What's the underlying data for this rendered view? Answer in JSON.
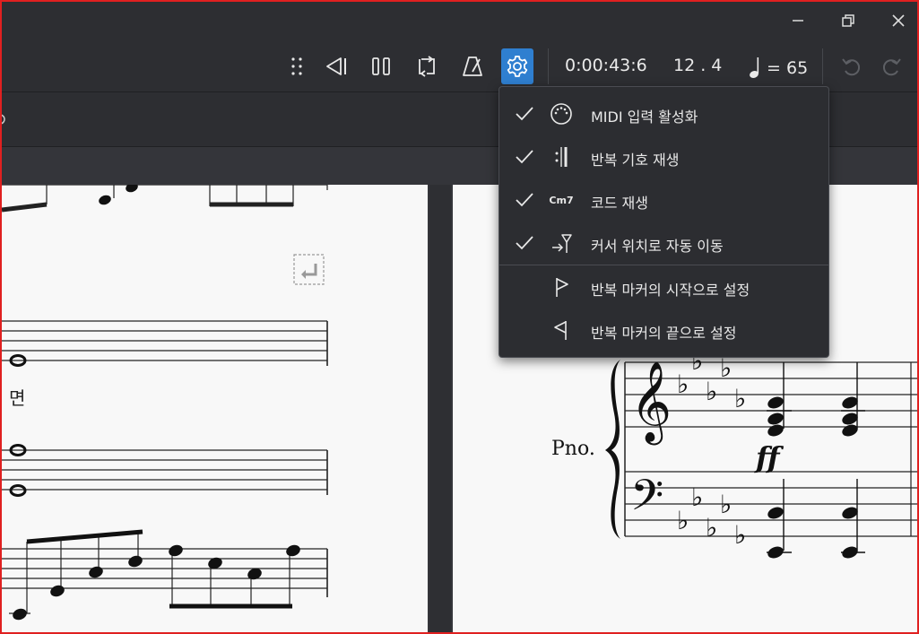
{
  "window": {
    "minimize_icon": "minimize-icon",
    "maximize_icon": "restore-icon",
    "close_icon": "close-icon"
  },
  "toolbar": {
    "time": "0:00:43:6",
    "position": "12 . 4",
    "tempo_equals": "= 65",
    "icons": [
      "drag-handle-icon",
      "rewind-icon",
      "pause-icon",
      "loop-icon",
      "metronome-icon",
      "settings-icon",
      "undo-icon",
      "redo-icon"
    ]
  },
  "menu": {
    "items": [
      {
        "label": "MIDI 입력 활성화",
        "checked": true,
        "icon": "midi-icon"
      },
      {
        "label": "반복 기호 재생",
        "checked": true,
        "icon": "repeat-sign-icon"
      },
      {
        "label": "코드 재생",
        "checked": true,
        "icon": "chord-icon",
        "icon_text": "Cm7"
      },
      {
        "label": "커서 위치로 자동 이동",
        "checked": true,
        "icon": "pan-cursor-icon"
      },
      {
        "label": "반복 마커의 시작으로 설정",
        "checked": false,
        "icon": "loop-in-flag-icon"
      },
      {
        "label": "반복 마커의 끝으로 설정",
        "checked": false,
        "icon": "loop-out-flag-icon"
      }
    ]
  },
  "score": {
    "left_text": "면",
    "instrument": "Pno.",
    "dynamic": "ff"
  },
  "colors": {
    "accent": "#2f7fd0",
    "frame": "#e02020",
    "background": "#2d2e32"
  }
}
